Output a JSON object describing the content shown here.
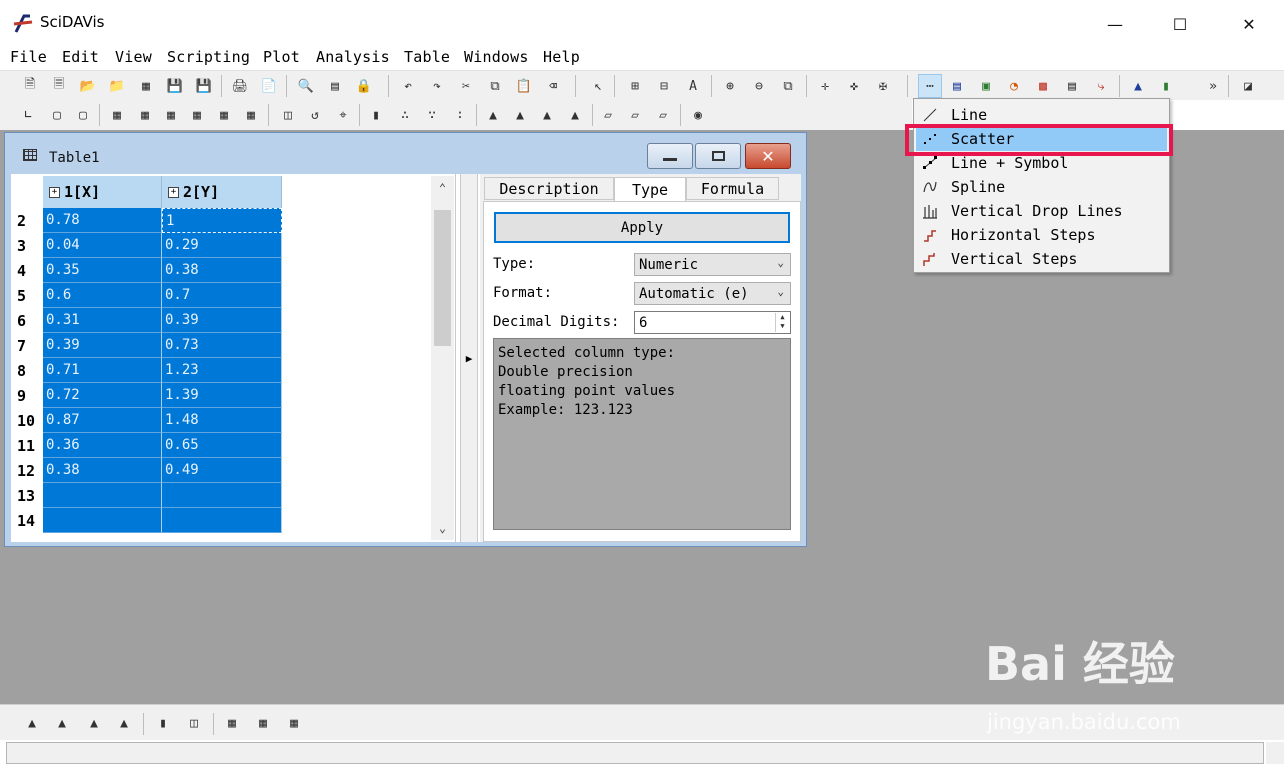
{
  "window": {
    "title": "SciDAVis"
  },
  "menu": [
    "File",
    "Edit",
    "View",
    "Scripting",
    "Plot",
    "Analysis",
    "Table",
    "Windows",
    "Help"
  ],
  "toolbar": {
    "overflow_label": "»"
  },
  "table_window": {
    "title": "Table1",
    "columns": [
      "1[X]",
      "2[Y]"
    ],
    "rows": [
      {
        "n": "2",
        "x": "0.78",
        "y": "1"
      },
      {
        "n": "3",
        "x": "0.04",
        "y": "0.29"
      },
      {
        "n": "4",
        "x": "0.35",
        "y": "0.38"
      },
      {
        "n": "5",
        "x": "0.6",
        "y": "0.7"
      },
      {
        "n": "6",
        "x": "0.31",
        "y": "0.39"
      },
      {
        "n": "7",
        "x": "0.39",
        "y": "0.73"
      },
      {
        "n": "8",
        "x": "0.71",
        "y": "1.23"
      },
      {
        "n": "9",
        "x": "0.72",
        "y": "1.39"
      },
      {
        "n": "10",
        "x": "0.87",
        "y": "1.48"
      },
      {
        "n": "11",
        "x": "0.36",
        "y": "0.65"
      },
      {
        "n": "12",
        "x": "0.38",
        "y": "0.49"
      },
      {
        "n": "13",
        "x": "",
        "y": ""
      },
      {
        "n": "14",
        "x": "",
        "y": ""
      }
    ]
  },
  "properties": {
    "tabs": [
      "Description",
      "Type",
      "Formula"
    ],
    "active_tab": "Type",
    "apply_label": "Apply",
    "type_label": "Type:",
    "type_value": "Numeric",
    "format_label": "Format:",
    "format_value": "Automatic (e)",
    "digits_label": "Decimal Digits:",
    "digits_value": "6",
    "info_text": "Selected column type:\nDouble precision\nfloating point values\nExample: 123.123"
  },
  "plot_menu": {
    "items": [
      "Line",
      "Scatter",
      "Line + Symbol",
      "Spline",
      "Vertical Drop Lines",
      "Horizontal Steps",
      "Vertical Steps"
    ],
    "highlighted": "Scatter",
    "highlight_color": "#e8164e"
  },
  "watermark": {
    "logo": "Bai 经验",
    "url": "jingyan.baidu.com"
  }
}
